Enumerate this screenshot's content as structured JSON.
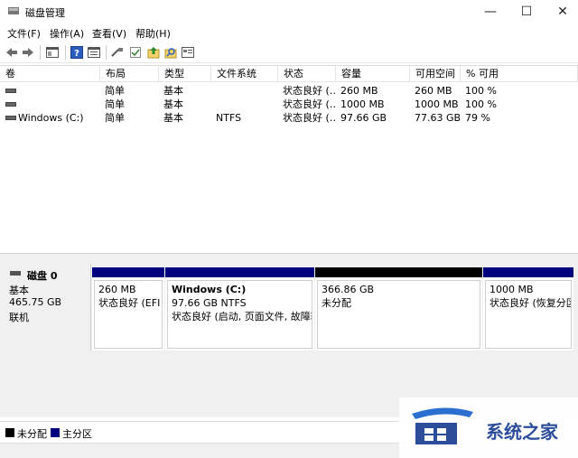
{
  "window": {
    "title": "磁盘管理",
    "minimize": "—",
    "maximize": "☐",
    "close": "✕"
  },
  "menu": [
    "文件(F)",
    "操作(A)",
    "查看(V)",
    "帮助(H)"
  ],
  "toolbar_icons": [
    "back-arrow-icon",
    "forward-arrow-icon",
    "show-hide-tree-icon",
    "help-icon",
    "properties-icon",
    "connect-icon",
    "check-icon",
    "up-icon",
    "search-icon",
    "details-icon"
  ],
  "columns": [
    "卷",
    "布局",
    "类型",
    "文件系统",
    "状态",
    "容量",
    "可用空间",
    "% 可用"
  ],
  "rows": [
    {
      "volume": "",
      "layout": "简单",
      "type": "基本",
      "fs": "",
      "status": "状态良好 (…",
      "capacity": "260 MB",
      "free": "260 MB",
      "pct": "100 %"
    },
    {
      "volume": "",
      "layout": "简单",
      "type": "基本",
      "fs": "",
      "status": "状态良好 (…",
      "capacity": "1000 MB",
      "free": "1000 MB",
      "pct": "100 %"
    },
    {
      "volume": "Windows (C:)",
      "layout": "简单",
      "type": "基本",
      "fs": "NTFS",
      "status": "状态良好 (…",
      "capacity": "97.66 GB",
      "free": "77.63 GB",
      "pct": "79 %"
    }
  ],
  "disk": {
    "name": "磁盘 0",
    "type": "基本",
    "size": "465.75 GB",
    "state": "联机"
  },
  "partitions": [
    {
      "name": "",
      "line1": "260 MB",
      "line2": "状态良好 (EFI 系",
      "bar": "#00007f"
    },
    {
      "name": "Windows  (C:)",
      "line1": "97.66 GB NTFS",
      "line2": "状态良好 (启动, 页面文件, 故障转",
      "bar": "#00007f"
    },
    {
      "name": "",
      "line1": "366.86 GB",
      "line2": "未分配",
      "bar": "#000000"
    },
    {
      "name": "",
      "line1": "1000 MB",
      "line2": "状态良好 (恢复分区",
      "bar": "#00007f"
    }
  ],
  "legend": [
    {
      "label": "未分配",
      "color": "#000000"
    },
    {
      "label": "主分区",
      "color": "#00007f"
    }
  ],
  "watermark": {
    "text": "系统之家"
  }
}
